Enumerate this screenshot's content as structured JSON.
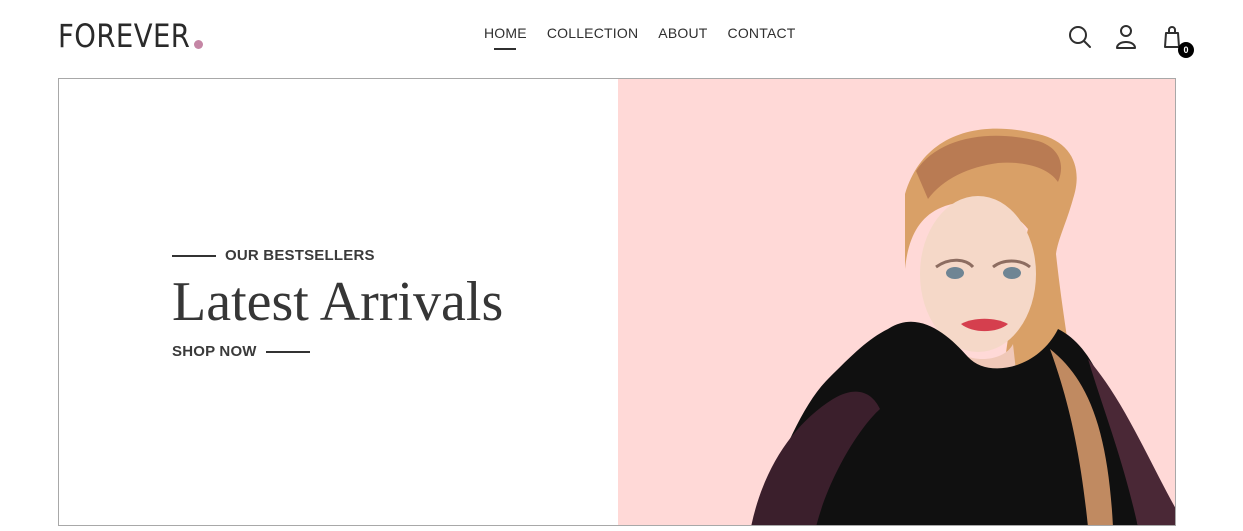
{
  "brand": {
    "name": "FOREVER",
    "dot_color": "#c586a5"
  },
  "nav": {
    "items": [
      {
        "label": "HOME",
        "active": true
      },
      {
        "label": "COLLECTION",
        "active": false
      },
      {
        "label": "ABOUT",
        "active": false
      },
      {
        "label": "CONTACT",
        "active": false
      }
    ]
  },
  "header_icons": {
    "search": "search-icon",
    "profile": "user-icon",
    "cart": "shopping-bag-icon",
    "cart_count": "0"
  },
  "hero": {
    "eyebrow": "OUR BESTSELLERS",
    "headline": "Latest Arrivals",
    "cta": "SHOP NOW",
    "image_bg": "#ffd9d7",
    "image_alt": "hero-model-image"
  }
}
